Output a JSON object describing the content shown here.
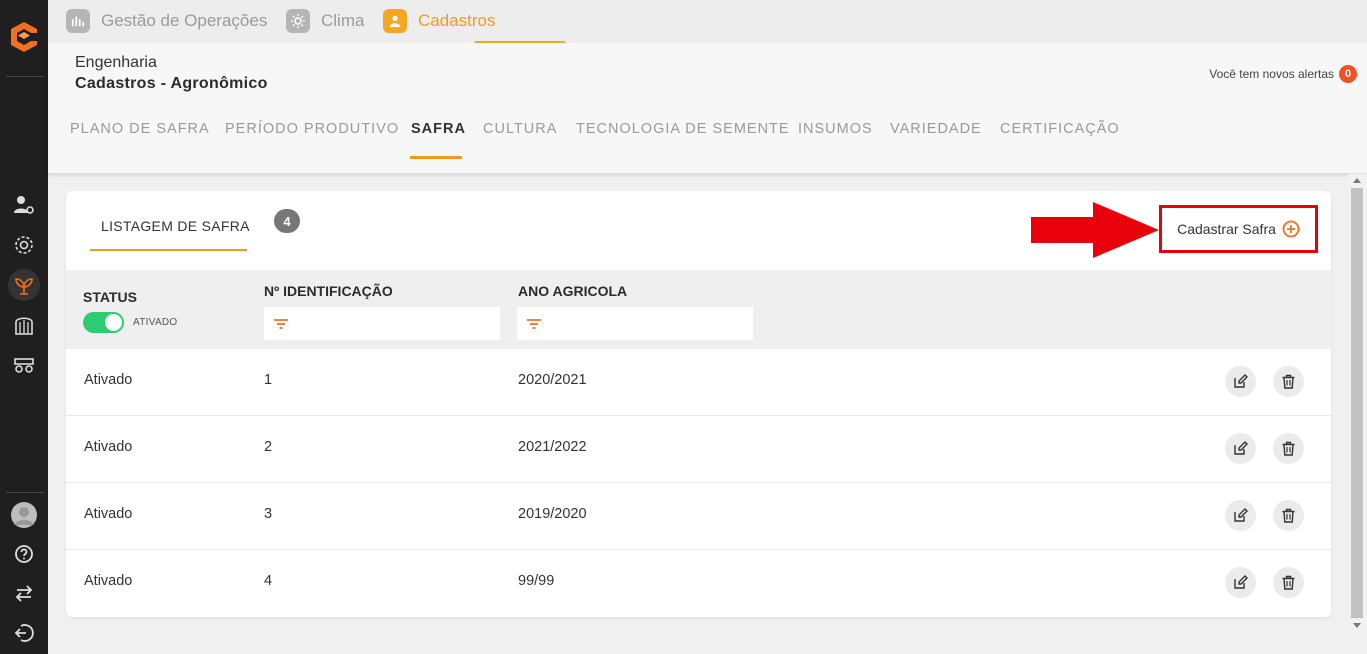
{
  "modules": [
    {
      "label": "Gestão de Operações",
      "icon": "operations-icon"
    },
    {
      "label": "Clima",
      "icon": "sun-icon"
    },
    {
      "label": "Cadastros",
      "icon": "user-icon",
      "active": true
    }
  ],
  "header": {
    "breadcrumb_top": "Engenharia",
    "breadcrumb_title": "Cadastros - Agronômico",
    "alerts_text": "Você tem novos alertas",
    "alerts_count": "0"
  },
  "tabs": [
    "PLANO DE SAFRA",
    "PERÍODO PRODUTIVO",
    "SAFRA",
    "CULTURA",
    "TECNOLOGIA DE SEMENTE",
    "INSUMOS",
    "VARIEDADE",
    "CERTIFICAÇÃO"
  ],
  "active_tab": "SAFRA",
  "card": {
    "list_tab": "LISTAGEM DE SAFRA",
    "count": "4",
    "new_button": "Cadastrar Safra"
  },
  "table": {
    "columns": {
      "status": "STATUS",
      "id": "Nº IDENTIFICAÇÃO",
      "year": "ANO AGRICOLA"
    },
    "status_toggle_label": "ATIVADO",
    "rows": [
      {
        "status": "Ativado",
        "id": "1",
        "year": "2020/2021"
      },
      {
        "status": "Ativado",
        "id": "2",
        "year": "2021/2022"
      },
      {
        "status": "Ativado",
        "id": "3",
        "year": "2019/2020"
      },
      {
        "status": "Ativado",
        "id": "4",
        "year": "99/99"
      }
    ]
  },
  "colors": {
    "accent": "#f39a1e",
    "sidebar": "#1f1f1f",
    "annotation": "#e8000b",
    "toggle_on": "#2ecc71"
  }
}
